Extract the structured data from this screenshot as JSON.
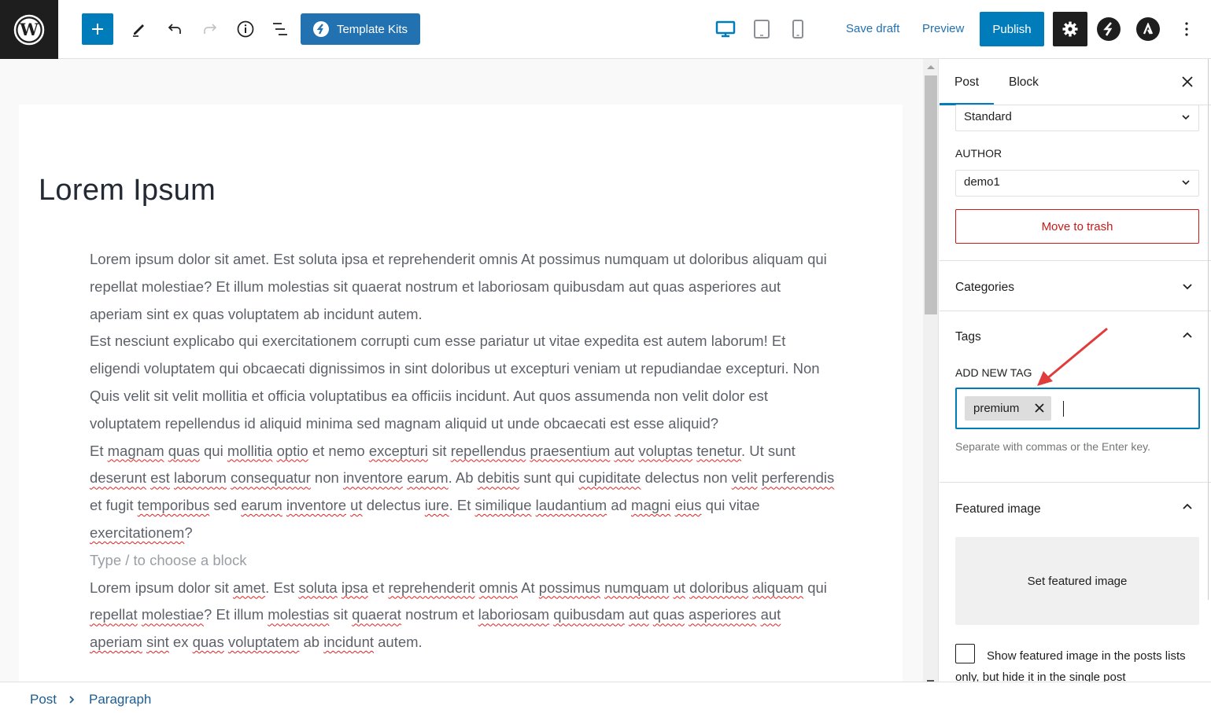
{
  "header": {
    "template_kits_label": "Template Kits",
    "save_draft_label": "Save draft",
    "preview_label": "Preview",
    "publish_label": "Publish",
    "colors": {
      "accent": "#007cba",
      "dark": "#1e1e1e",
      "link": "#2271b1"
    }
  },
  "editor": {
    "title": "Lorem Ipsum",
    "paragraph1": "Lorem ipsum dolor sit amet. Est soluta ipsa et reprehenderit omnis At possimus numquam ut doloribus aliquam qui repellat molestiae? Et illum molestias sit quaerat nostrum et laboriosam quibusdam aut quas asperiores aut aperiam sint ex quas voluptatem ab incidunt autem.",
    "paragraph2": "Est nesciunt explicabo qui exercitationem corrupti cum esse pariatur ut vitae expedita est autem laborum! Et eligendi voluptatem qui obcaecati dignissimos in sint doloribus ut excepturi veniam ut repudiandae excepturi. Non Quis velit sit velit mollitia et officia voluptatibus ea officiis incidunt. Aut quos assumenda non velit dolor est voluptatem repellendus id aliquid minima sed magnam aliquid ut unde obcaecati est esse aliquid?",
    "paragraph3_words": [
      "Et",
      "magnam*",
      "quas*",
      "qui",
      "mollitia*",
      "optio*",
      "et",
      "nemo",
      "excepturi*",
      "sit",
      "repellendus*",
      "praesentium*",
      "aut*",
      "voluptas*",
      "tenetur*.",
      "Ut",
      "sunt",
      "deserunt*",
      "est*",
      "laborum*",
      "consequatur*",
      "non",
      "inventore*",
      "earum*.",
      "Ab",
      "debitis*",
      "sunt",
      "qui",
      "cupiditate*",
      "delectus",
      "non",
      "velit*",
      "perferendis*",
      "et",
      "fugit",
      "temporibus*",
      "sed",
      "earum*",
      "inventore*",
      "ut*",
      "delectus",
      "iure*.",
      "Et",
      "similique*",
      "laudantium*",
      "ad",
      "magni*",
      "eius*",
      "qui",
      "vitae",
      "exercitationem*?"
    ],
    "placeholder": "Type / to choose a block",
    "paragraph4_words": [
      "Lorem",
      "ipsum",
      "dolor",
      "sit",
      "amet*.",
      "Est",
      "soluta*",
      "ipsa*",
      "et",
      "reprehenderit*",
      "omnis*",
      "At",
      "possimus*",
      "numquam*",
      "ut*",
      "doloribus*",
      "aliquam*",
      "qui",
      "repellat*",
      "molestiae*?",
      "Et",
      "illum",
      "molestias*",
      "sit",
      "quaerat*",
      "nostrum",
      "et",
      "laboriosam*",
      "quibusdam*",
      "aut*",
      "quas*",
      "asperiores*",
      "aut*",
      "aperiam*",
      "sint*",
      "ex",
      "quas*",
      "voluptatem*",
      "ab",
      "incidunt*",
      "autem."
    ]
  },
  "sidebar": {
    "tabs": [
      {
        "label": "Post",
        "active": true
      },
      {
        "label": "Block",
        "active": false
      }
    ],
    "format_value": "Standard",
    "author_label": "AUTHOR",
    "author_value": "demo1",
    "trash_label": "Move to trash",
    "categories_label": "Categories",
    "tags_label": "Tags",
    "add_tag_label": "ADD NEW TAG",
    "tags": [
      "premium"
    ],
    "tag_help": "Separate with commas or the Enter key.",
    "featured_label": "Featured image",
    "set_featured_label": "Set featured image",
    "featured_checkbox_label": "Show featured image in the posts lists only, but hide it in the single post",
    "featured_checkbox_checked": false
  },
  "footer": {
    "breadcrumb": [
      "Post",
      "Paragraph"
    ]
  },
  "annotation": {
    "type": "arrow",
    "color": "#e03c3c",
    "points_to": "add-tag-input"
  }
}
